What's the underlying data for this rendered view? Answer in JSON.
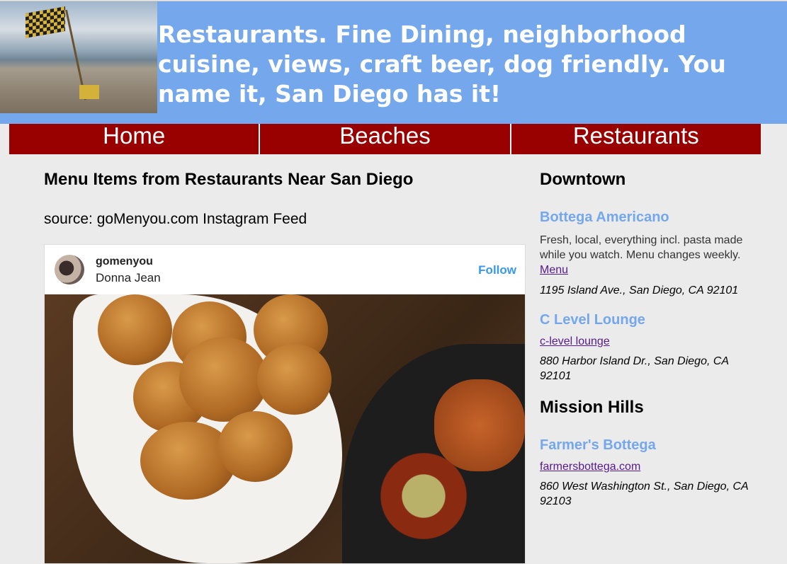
{
  "header": {
    "title": "Restaurants. Fine Dining, neighborhood cuisine, views, craft beer, dog friendly. You name it, San Diego has it!",
    "color": "#74a7eb"
  },
  "nav": {
    "items": [
      {
        "label": "Home"
      },
      {
        "label": "Beaches"
      },
      {
        "label": "Restaurants"
      }
    ],
    "color": "#990000"
  },
  "main": {
    "title": "Menu Items from Restaurants Near San Diego",
    "source": "source: goMenyou.com Instagram Feed",
    "feed": {
      "username": "gomenyou",
      "display_name": "Donna Jean",
      "follow_label": "Follow"
    }
  },
  "sidebar": {
    "sections": [
      {
        "title": "Downtown",
        "restaurants": [
          {
            "name": "Bottega Americano",
            "description": "Fresh, local, everything incl. pasta made while you watch. Menu changes weekly.",
            "link": "Menu",
            "address": "1195 Island Ave., San Diego, CA 92101"
          },
          {
            "name": "C Level Lounge",
            "link": "c-level lounge",
            "address": "880 Harbor Island Dr., San Diego, CA 92101"
          }
        ]
      },
      {
        "title": "Mission Hills",
        "restaurants": [
          {
            "name": "Farmer's Bottega",
            "link": "farmersbottega.com",
            "address": "860 West Washington St., San Diego, CA 92103"
          }
        ]
      }
    ]
  }
}
